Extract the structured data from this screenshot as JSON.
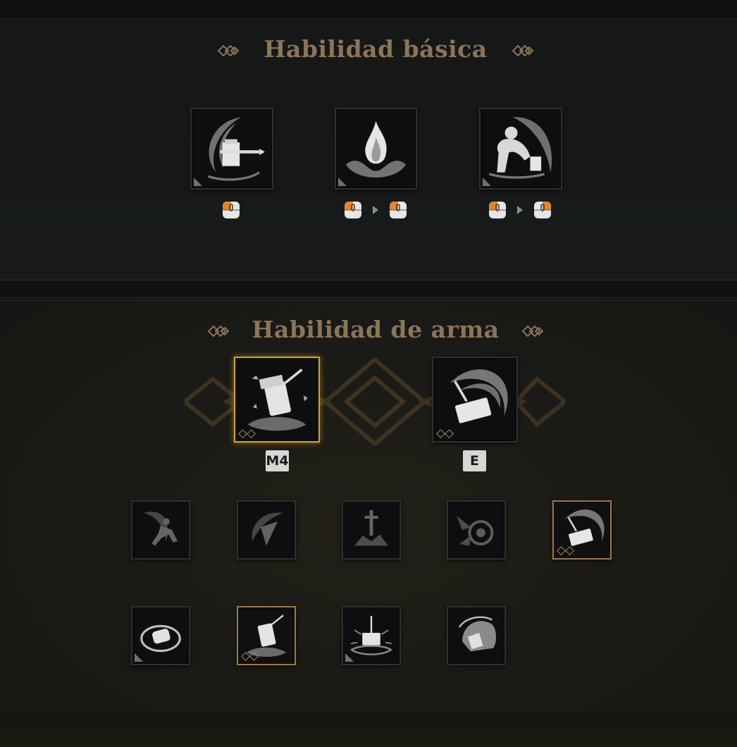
{
  "basic_section": {
    "title": "Habilidad básica",
    "abilities": [
      {
        "icon": "hammer-swing-icon",
        "inputs": [
          "left-click"
        ]
      },
      {
        "icon": "flame-burst-icon",
        "inputs": [
          "left-click",
          "left-click"
        ]
      },
      {
        "icon": "crouch-hammer-icon",
        "inputs": [
          "left-click",
          "right-click"
        ]
      }
    ]
  },
  "weapon_section": {
    "title": "Habilidad de arma",
    "equipped": [
      {
        "icon": "ground-slam-icon",
        "key": "M4",
        "selected": true
      },
      {
        "icon": "spinning-hammer-icon",
        "key": "E",
        "selected": false
      }
    ],
    "skills_row1": [
      {
        "icon": "dash-runner-icon",
        "state": "locked"
      },
      {
        "icon": "spear-slash-icon",
        "state": "locked"
      },
      {
        "icon": "sword-stuck-icon",
        "state": "locked"
      },
      {
        "icon": "shield-impact-icon",
        "state": "locked"
      },
      {
        "icon": "spinning-hammer-icon",
        "state": "equipped"
      }
    ],
    "skills_row2": [
      {
        "icon": "hammer-orbit-icon",
        "state": "available"
      },
      {
        "icon": "ground-slam-icon",
        "state": "equipped"
      },
      {
        "icon": "hammer-drop-icon",
        "state": "available"
      },
      {
        "icon": "helmet-charge-icon",
        "state": "available"
      }
    ]
  },
  "colors": {
    "title": "#8c7558",
    "selected_border": "#d9a128",
    "equipped_border": "#a07a45",
    "mouse_accent": "#e8851f"
  }
}
